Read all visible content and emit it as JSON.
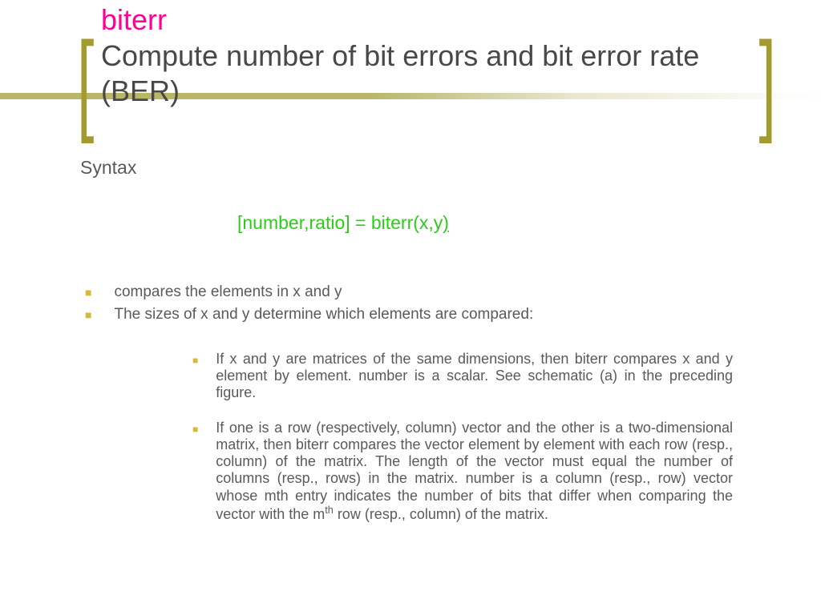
{
  "header": {
    "function_name": "biterr",
    "subtitle": "Compute number of bit errors and bit error rate (BER)"
  },
  "syntax": {
    "label": "Syntax",
    "code_main": "[number,ratio] = biterr(x,y",
    "code_close": ")"
  },
  "bullets": {
    "b1": "compares the elements in x and y",
    "b2": "The sizes of x and y determine which elements are compared:",
    "sub1": "If x and y are matrices of the same dimensions, then biterr compares x and y element by element. number is a scalar. See schematic (a) in the preceding figure.",
    "sub2_a": "If one is a row (respectively, column) vector and the other is a two-dimensional matrix, then biterr compares the vector element by element with each row (resp., column) of the matrix. The length of the vector must equal the number of columns (resp., rows) in the matrix. number is a column (resp., row) vector whose mth entry indicates the number of bits that differ when comparing the vector with the m",
    "sub2_sup": "th",
    "sub2_b": " row (resp., column) of the matrix."
  }
}
